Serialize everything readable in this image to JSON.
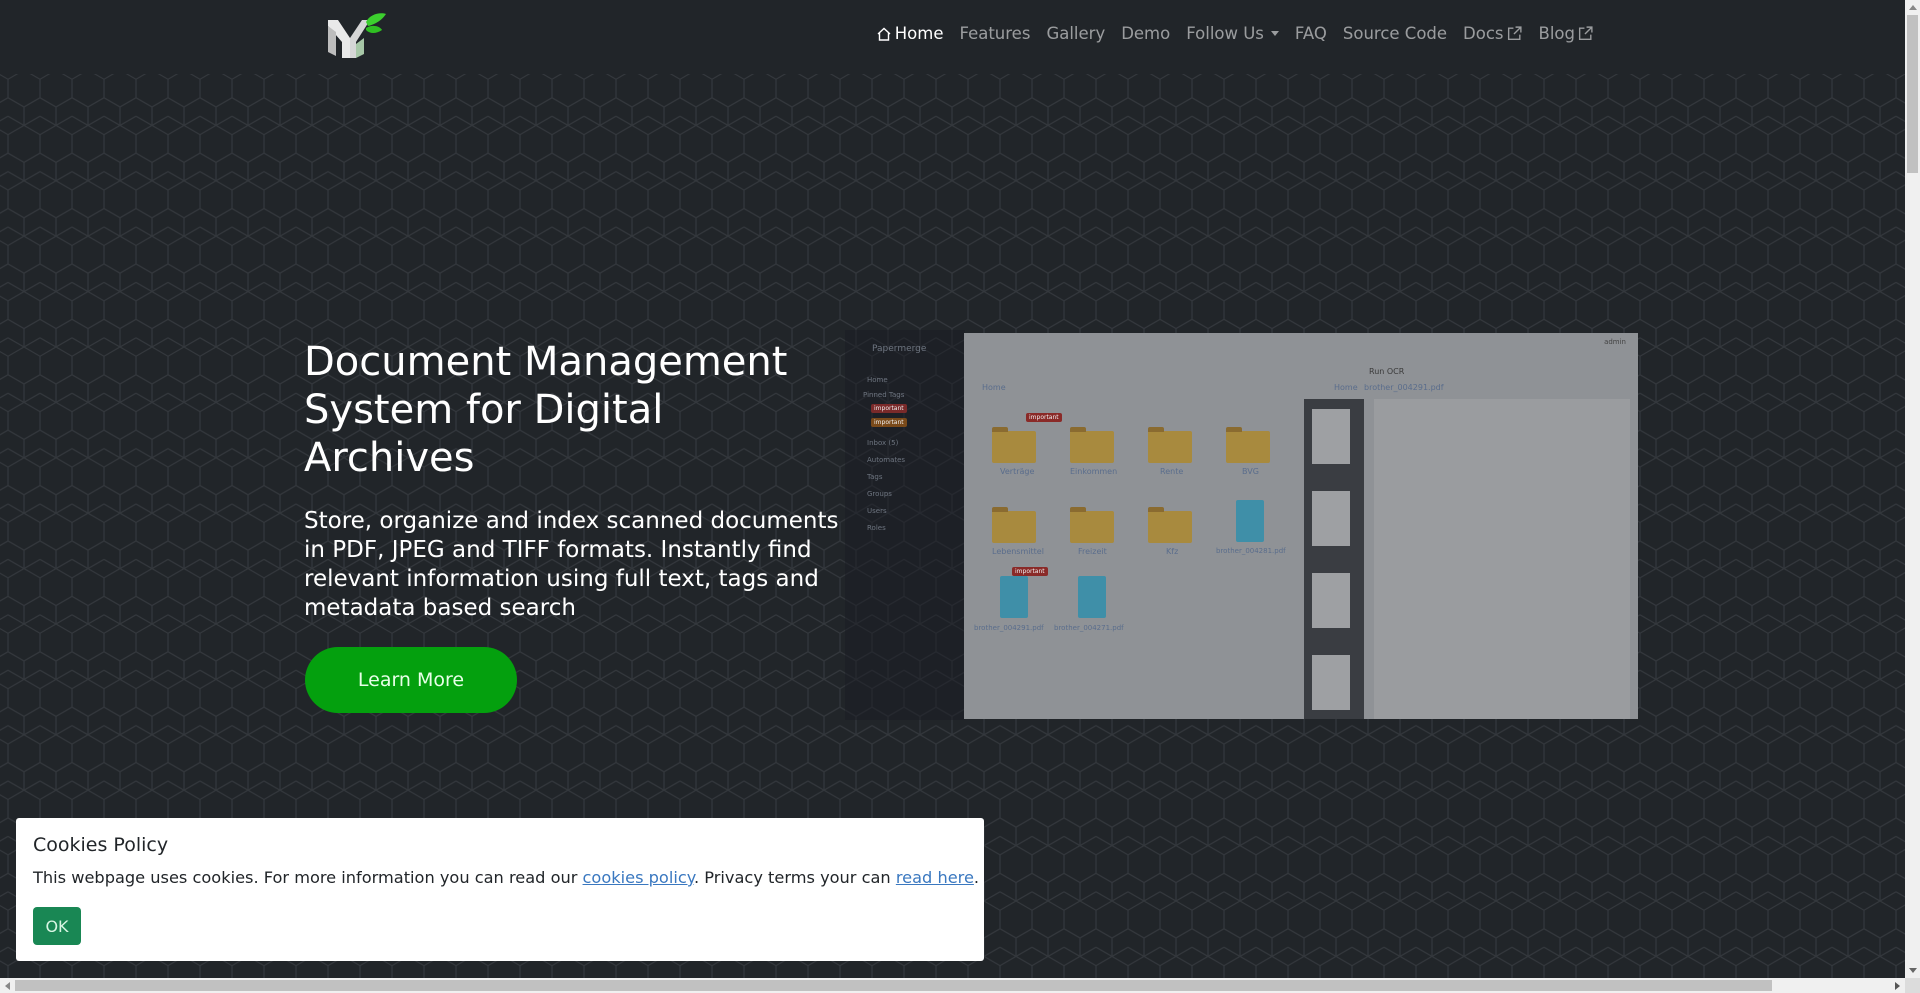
{
  "navbar": {
    "logo_alt": "Papermerge logo",
    "items": [
      {
        "label": "Home",
        "icon": "home-icon",
        "active": true
      },
      {
        "label": "Features"
      },
      {
        "label": "Gallery"
      },
      {
        "label": "Demo"
      },
      {
        "label": "Follow Us",
        "dropdown": true
      },
      {
        "label": "FAQ"
      },
      {
        "label": "Source Code"
      },
      {
        "label": "Docs",
        "icon": "external-link-icon"
      },
      {
        "label": "Blog",
        "icon": "external-link-icon"
      }
    ]
  },
  "hero": {
    "title": "Document Management System for Digital Archives",
    "subtitle": "Store, organize and index scanned documents in PDF, JPEG and TIFF formats. Instantly find relevant information using full text, tags and metadata based search",
    "cta_label": "Learn More",
    "cta_color": "#04a00e"
  },
  "app_screenshot": {
    "brand": "Papermerge",
    "user": "admin",
    "sidebar": [
      "Home",
      "Pinned Tags",
      "important",
      "important",
      "Inbox (5)",
      "Automates",
      "Tags",
      "Groups",
      "Users",
      "Roles"
    ],
    "breadcrumb_left": "Home",
    "breadcrumb_right": [
      "Home",
      "brother_004291.pdf"
    ],
    "run_ocr_label": "Run OCR",
    "folders": [
      "Verträge",
      "Einkommen",
      "Rente",
      "BVG",
      "Lebensmittel",
      "Freizeit",
      "Kfz"
    ],
    "documents": [
      "brother_004281.pdf",
      "brother_004291.pdf",
      "brother_004271.pdf"
    ],
    "tags": {
      "important": "#c0392b",
      "archive": "#c06020",
      "paid": "#3a8c1c"
    }
  },
  "cookies": {
    "title": "Cookies Policy",
    "text_before": "This webpage uses cookies. For more information you can read our ",
    "link1": "cookies policy",
    "text_middle": ". Privacy terms your can ",
    "link2": "read here",
    "text_after": ".",
    "ok_label": "OK",
    "ok_color": "#198754"
  }
}
